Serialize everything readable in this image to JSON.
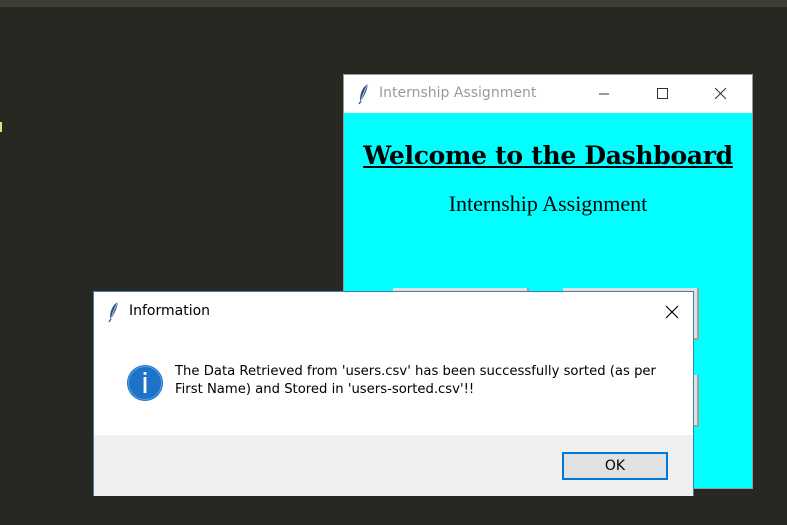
{
  "main_window": {
    "title": "Internship Assignment",
    "heading": "Welcome to the Dashboard",
    "subheading": "Internship Assignment",
    "background": "#00ffff"
  },
  "dialog": {
    "title": "Information",
    "message_line1": "The Data Retrieved from 'users.csv' has been successfully sorted (as per",
    "message_line2": "First Name) and Stored in 'users-sorted.csv'!!",
    "ok_label": "OK",
    "icon": "info-icon",
    "accent": "#0078d7"
  },
  "icons": {
    "app_icon": "feather-icon",
    "minimize": "minimize-icon",
    "maximize": "maximize-icon",
    "close": "close-icon"
  }
}
